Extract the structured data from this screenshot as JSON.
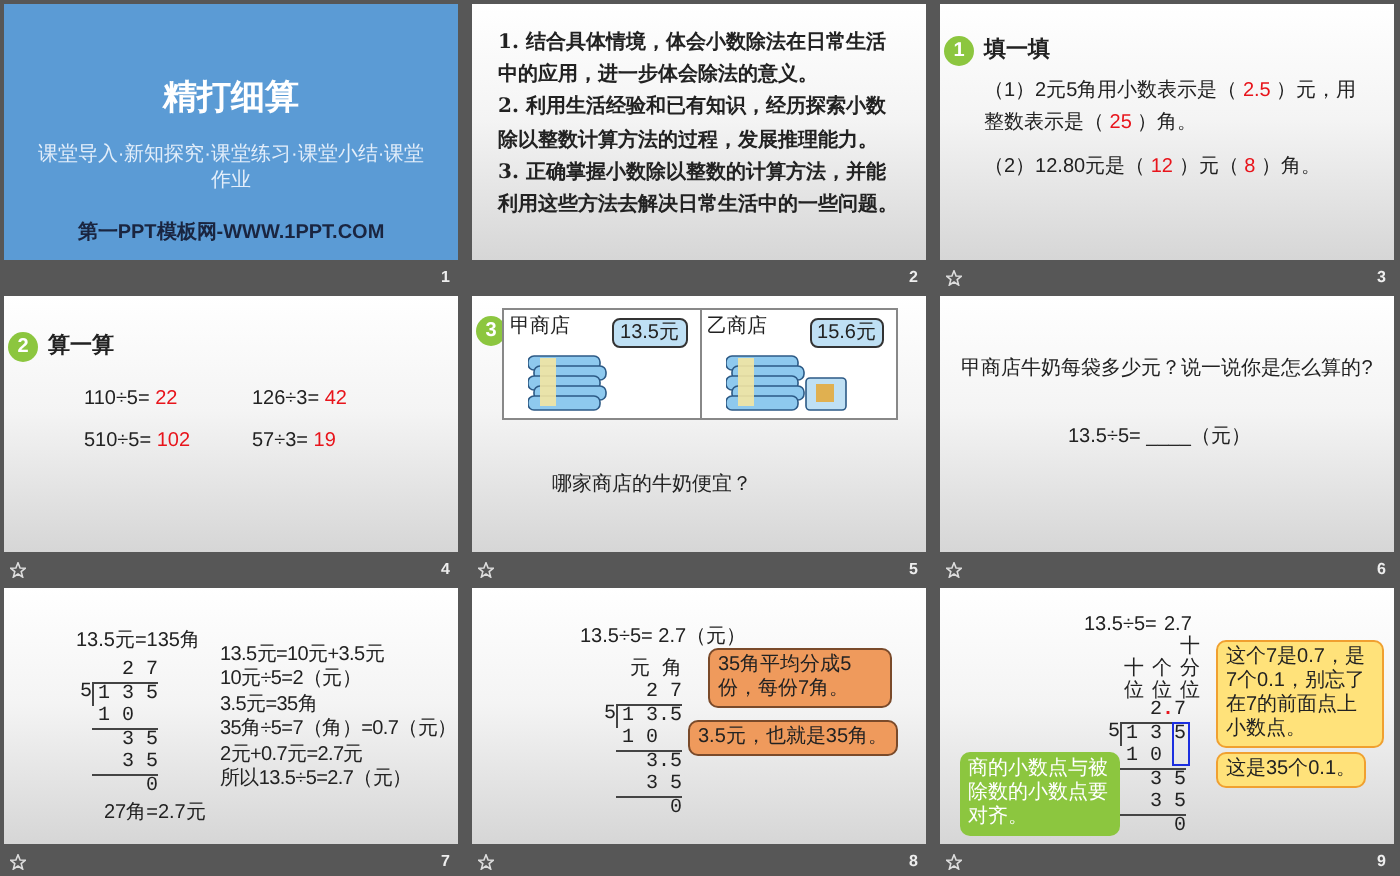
{
  "slides": [
    {
      "number": "1",
      "kind": "title",
      "transition": false,
      "title": "精打细算",
      "subtitle": "课堂导入·新知探究·课堂练习·课堂小结·课堂作业",
      "footer": "第一PPT模板网-WWW.1PPT.COM"
    },
    {
      "number": "2",
      "kind": "objectives",
      "transition": false,
      "paragraphs": [
        "1. 结合具体情境，体会小数除法在日常生活中的应用，进一步体会除法的意义。",
        "2. 利用生活经验和已有知识，经历探索小数除以整数计算方法的过程，发展推理能力。",
        "3. 正确掌握小数除以整数的计算方法，并能利用这些方法去解决日常生活中的一些问题。"
      ]
    },
    {
      "number": "3",
      "kind": "fill",
      "transition": true,
      "badge": "1",
      "heading": "填一填",
      "items": [
        [
          {
            "text": "（1）2元5角用小数表示是（ ",
            "answer": false
          },
          {
            "text": "2.5",
            "answer": true
          },
          {
            "text": " ）元，用整数表示是（ ",
            "answer": false
          },
          {
            "text": "25",
            "answer": true
          },
          {
            "text": " ）角。",
            "answer": false
          }
        ],
        [
          {
            "text": "（2）12.80元是（ ",
            "answer": false
          },
          {
            "text": "12",
            "answer": true
          },
          {
            "text": " ）元（ ",
            "answer": false
          },
          {
            "text": "8",
            "answer": true
          },
          {
            "text": " ）角。",
            "answer": false
          }
        ]
      ]
    },
    {
      "number": "4",
      "kind": "calc",
      "transition": true,
      "badge": "2",
      "heading": "算一算",
      "problems": [
        {
          "expr": "110÷5=",
          "answer": "22"
        },
        {
          "expr": "126÷3=",
          "answer": "42"
        },
        {
          "expr": "510÷5=",
          "answer": "102"
        },
        {
          "expr": "57÷3=",
          "answer": "19"
        }
      ]
    },
    {
      "number": "5",
      "kind": "shops",
      "transition": true,
      "badge": "3",
      "panels": [
        {
          "label": "甲商店",
          "price": "13.5元"
        },
        {
          "label": "乙商店",
          "price": "15.6元"
        }
      ],
      "question": "哪家商店的牛奶便宜？"
    },
    {
      "number": "6",
      "kind": "question",
      "transition": true,
      "question": "甲商店牛奶每袋多少元？说一说你是怎么算的?",
      "equation": "13.5÷5= ____（元）"
    },
    {
      "number": "7",
      "kind": "division-steps",
      "transition": true,
      "heading": "13.5元=135角",
      "division": {
        "quotient": [
          {
            "text": "2 7",
            "emphasis": false
          }
        ],
        "divisor": "5",
        "dividend": "1 3 5",
        "steps": [
          "1 0",
          "3 5",
          "3 5",
          "0"
        ]
      },
      "result": "27角=2.7元",
      "explanation": [
        "13.5元=10元+3.5元",
        "10元÷5=2（元）",
        "3.5元=35角",
        "35角÷5=7（角）=0.7（元）",
        "2元+0.7元=2.7元",
        "所以13.5÷5=2.7（元）"
      ]
    },
    {
      "number": "8",
      "kind": "division-units",
      "transition": true,
      "heading": "13.5÷5= 2.7（元）",
      "units": "元 角",
      "division": {
        "quotient": [
          {
            "text": "2 7",
            "emphasis": false
          }
        ],
        "divisor": "5",
        "dividend": "1 3.5",
        "steps": [
          "1 0",
          "3.5",
          "3 5",
          "0"
        ]
      },
      "callouts": [
        "35角平均分成5份，每份7角。",
        "3.5元，也就是35角。"
      ]
    },
    {
      "number": "9",
      "kind": "division-places",
      "transition": true,
      "equation": "13.5÷5=",
      "result": "2.7",
      "places": [
        "十位",
        "个位",
        "十分位"
      ],
      "division": {
        "quotient": [
          {
            "text": "2",
            "emphasis": false
          },
          {
            "text": ".",
            "emphasis": true
          },
          {
            "text": "7",
            "emphasis": false
          }
        ],
        "divisor": "5",
        "dividend": "1 3 5",
        "steps": [
          "1 0",
          "3  5",
          "3 5",
          "0"
        ]
      },
      "callouts": [
        "这个7是0.7，是7个0.1，别忘了在7的前面点上小数点。",
        "这是35个0.1。"
      ],
      "note": "商的小数点与被除数的小数点要对齐。"
    }
  ]
}
